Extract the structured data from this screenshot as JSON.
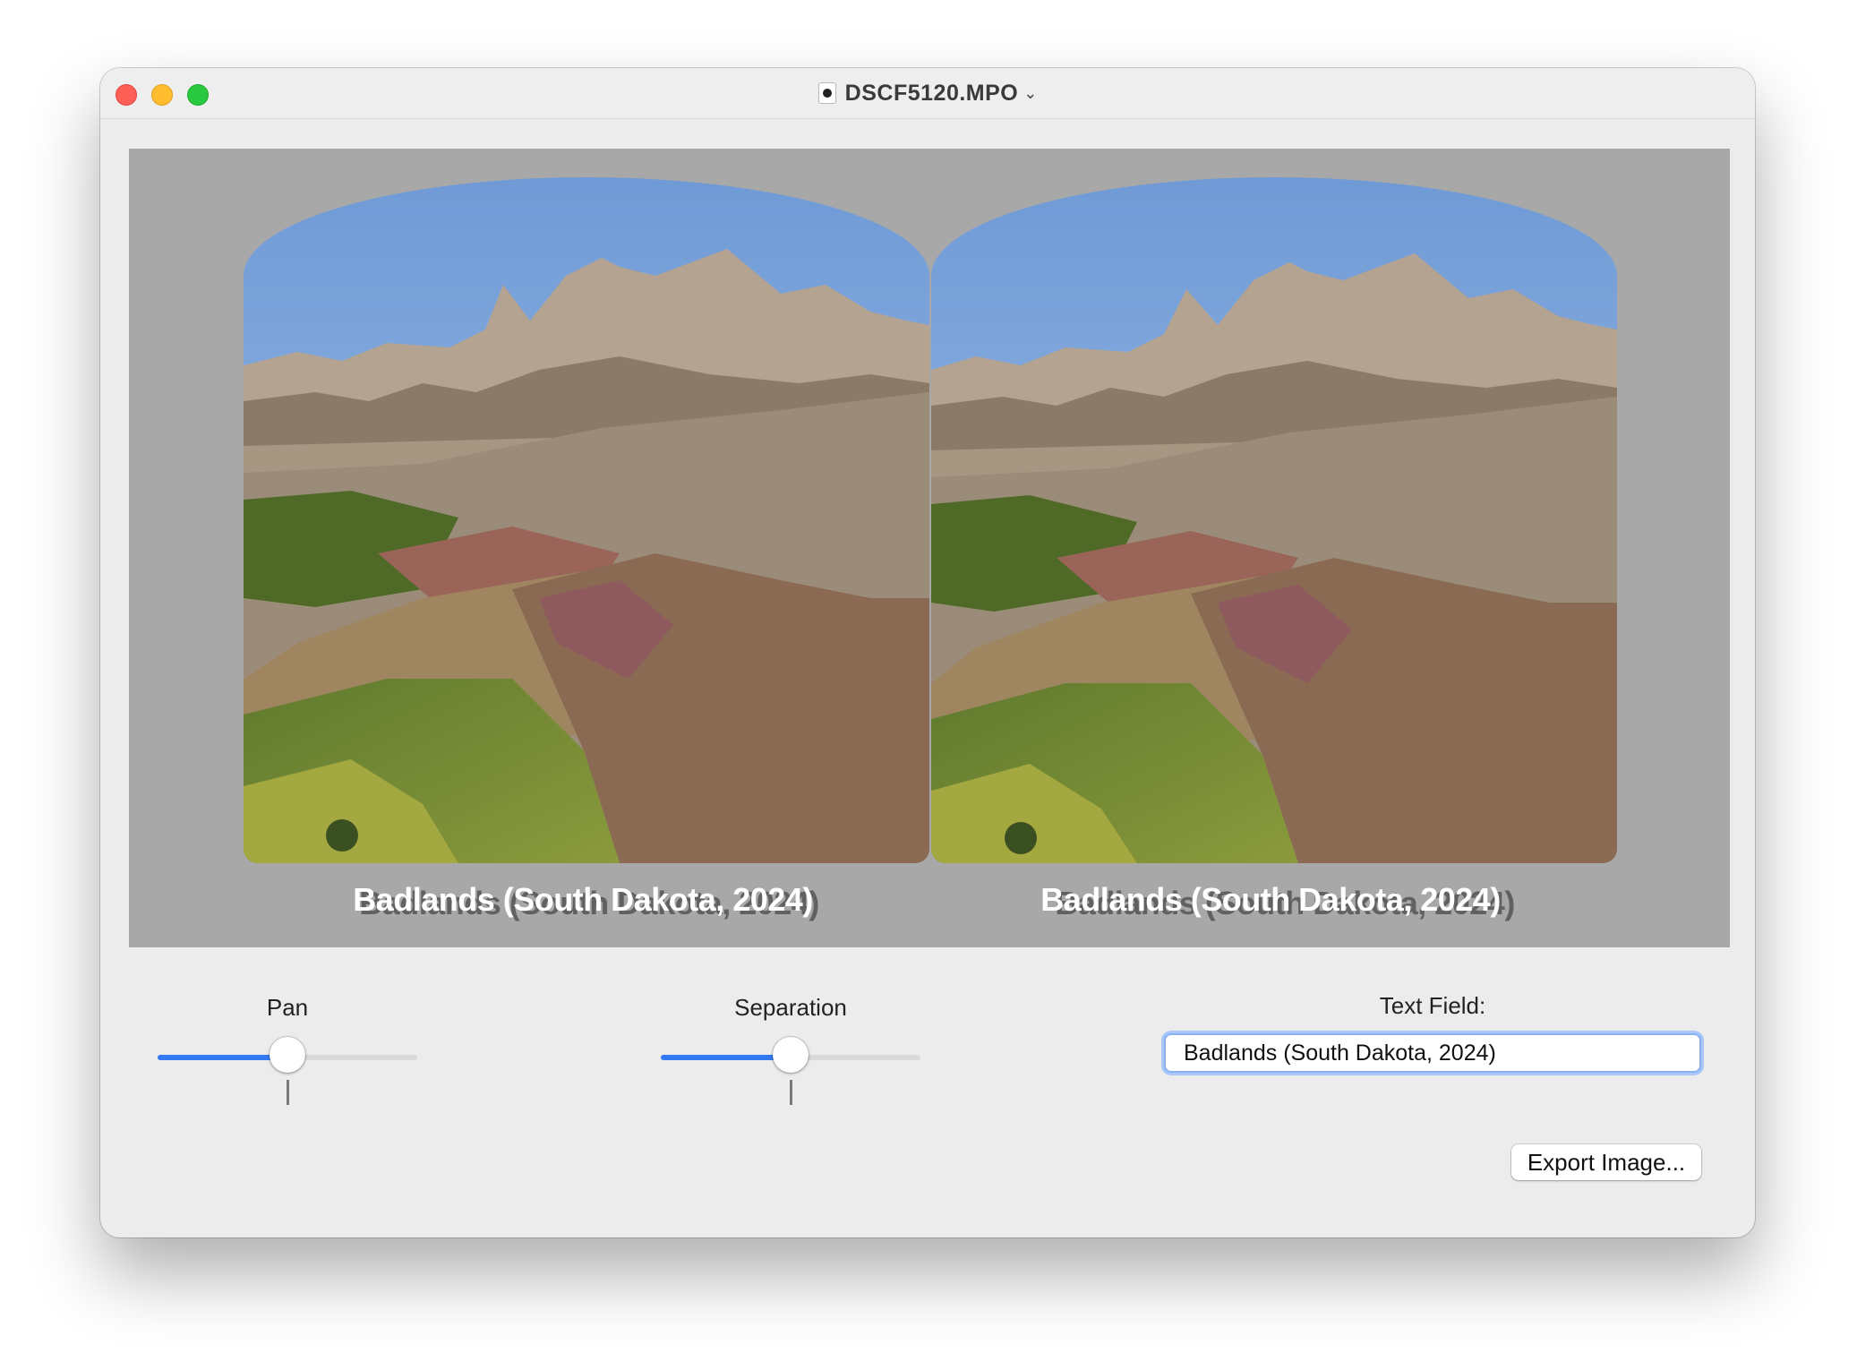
{
  "window": {
    "title": "DSCF5120.MPO",
    "title_chevron": "⌄",
    "title_icon": "mpo-document-icon"
  },
  "viewer": {
    "caption_left": "Badlands (South Dakota, 2024)",
    "caption_right": "Badlands (South Dakota, 2024)",
    "background": "#a8a8a8"
  },
  "controls": {
    "pan": {
      "label": "Pan",
      "value_fraction": 0.5
    },
    "separation": {
      "label": "Separation",
      "value_fraction": 0.5
    },
    "text_field": {
      "label": "Text Field:",
      "value": "Badlands (South Dakota, 2024)"
    },
    "export_button": "Export Image..."
  },
  "colors": {
    "accent": "#3478f6",
    "close": "#fe5f57",
    "minimize": "#febc2e",
    "zoom": "#28c840"
  }
}
